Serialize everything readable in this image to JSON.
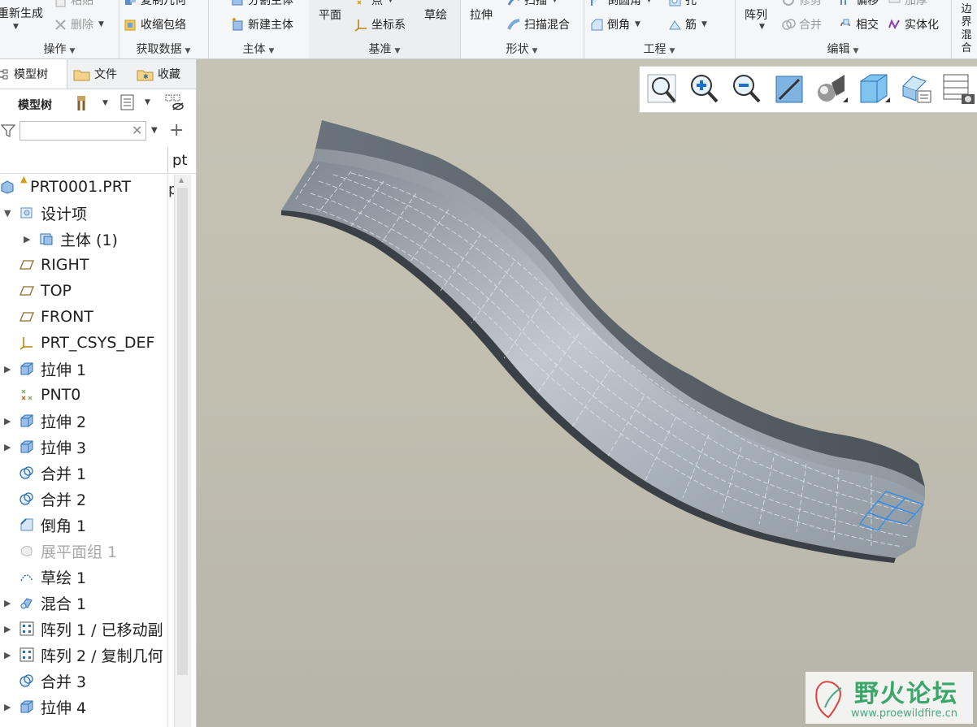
{
  "ribbon": {
    "groups": [
      {
        "label": "操作",
        "items": [
          "重新生成",
          "粘贴",
          "删除"
        ]
      },
      {
        "label": "获取数据",
        "items": [
          "复制几何",
          "收缩包络"
        ]
      },
      {
        "label": "主体",
        "items": [
          "分割主体",
          "新建主体"
        ]
      },
      {
        "label": "基准",
        "items": [
          "平面",
          "点",
          "坐标系",
          "草绘"
        ]
      },
      {
        "label": "形状",
        "items": [
          "拉伸",
          "扫描",
          "扫描混合"
        ]
      },
      {
        "label": "工程",
        "items": [
          "倒圆角",
          "倒角",
          "孔",
          "筋"
        ]
      },
      {
        "label": "编辑",
        "items": [
          "阵列",
          "修剪",
          "合并",
          "偏移",
          "相交",
          "加厚",
          "实体化"
        ]
      },
      {
        "label": "",
        "items": [
          "边界混合"
        ]
      }
    ]
  },
  "panel": {
    "tabs": [
      "模型树",
      "文件",
      "收藏"
    ],
    "toolbar_label": "模型树",
    "search_placeholder": "",
    "column_header": "pt",
    "column_header_sub": "p"
  },
  "tree": {
    "items": [
      {
        "label": "PRT0001.PRT",
        "icon": "part-icon"
      },
      {
        "label": "设计项",
        "icon": "design-items-icon"
      },
      {
        "label": "主体 (1)",
        "icon": "body-icon"
      },
      {
        "label": "RIGHT",
        "icon": "datum-plane-icon"
      },
      {
        "label": "TOP",
        "icon": "datum-plane-icon"
      },
      {
        "label": "FRONT",
        "icon": "datum-plane-icon"
      },
      {
        "label": "PRT_CSYS_DEF",
        "icon": "csys-icon"
      },
      {
        "label": "拉伸 1",
        "icon": "extrude-icon"
      },
      {
        "label": "PNT0",
        "icon": "datum-point-icon"
      },
      {
        "label": "拉伸 2",
        "icon": "extrude-icon"
      },
      {
        "label": "拉伸 3",
        "icon": "extrude-icon"
      },
      {
        "label": "合并 1",
        "icon": "merge-icon"
      },
      {
        "label": "合并 2",
        "icon": "merge-icon"
      },
      {
        "label": "倒角 1",
        "icon": "chamfer-icon"
      },
      {
        "label": "展平面组 1",
        "icon": "flatten-quilt-icon"
      },
      {
        "label": "草绘 1",
        "icon": "sketch-icon"
      },
      {
        "label": "混合 1",
        "icon": "blend-icon"
      },
      {
        "label": "阵列 1 / 已移动副",
        "icon": "pattern-icon"
      },
      {
        "label": "阵列 2 / 复制几何",
        "icon": "pattern-icon"
      },
      {
        "label": "合并 3",
        "icon": "merge-icon"
      },
      {
        "label": "拉伸 4",
        "icon": "extrude-icon"
      }
    ]
  },
  "viewport": {
    "toolbar": [
      "zoom-fit-icon",
      "zoom-in-icon",
      "zoom-out-icon",
      "repaint-icon",
      "display-style-icon",
      "saved-views-icon",
      "named-views-icon",
      "view-manager-icon"
    ]
  },
  "watermark": {
    "brand": "野火论坛",
    "url": "www.proewildfire.cn"
  }
}
